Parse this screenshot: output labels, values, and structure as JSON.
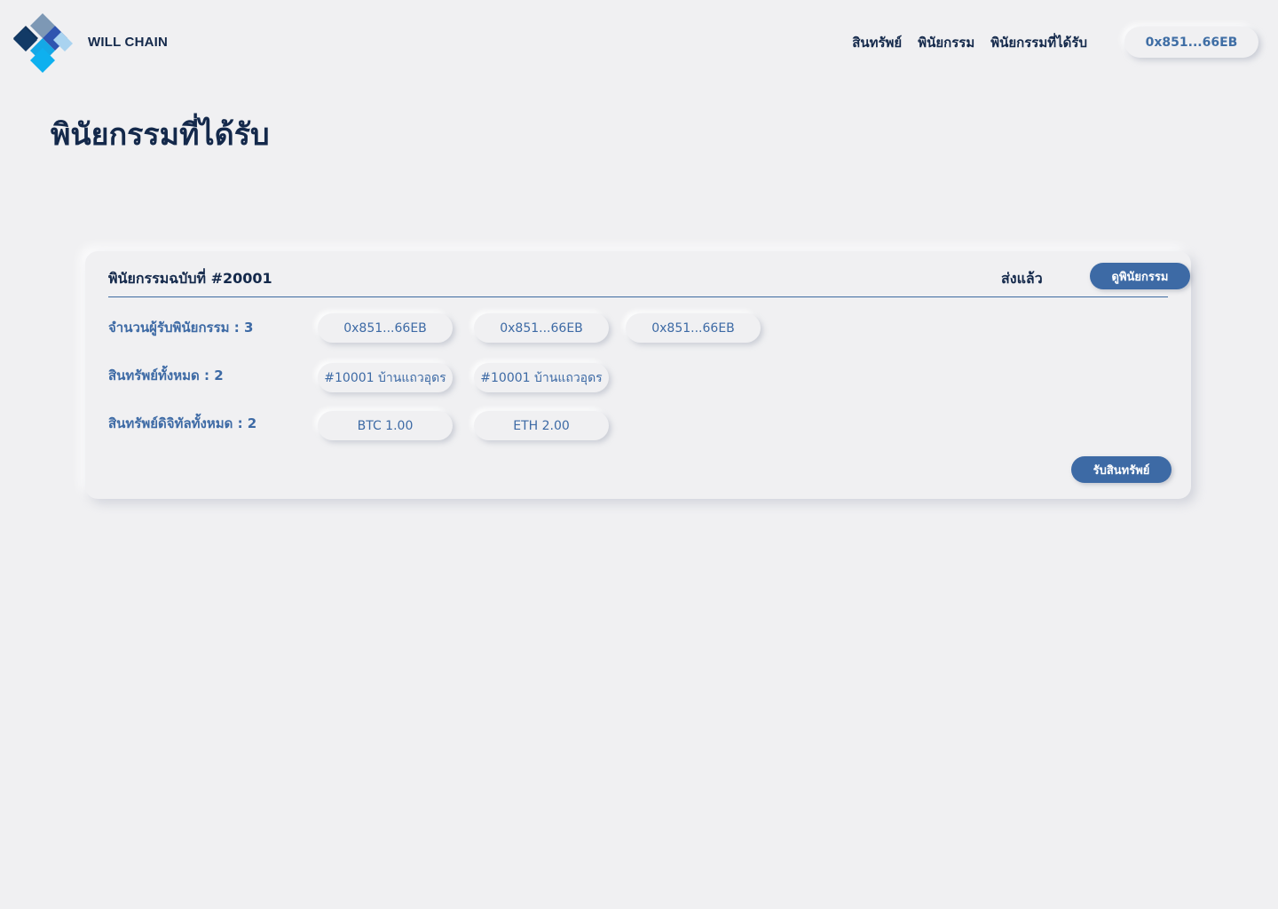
{
  "header": {
    "brand": "WILL CHAIN",
    "nav": [
      "สินทรัพย์",
      "พินัยกรรม",
      "พินัยกรรมที่ได้รับ"
    ],
    "wallet": "0x851...66EB"
  },
  "page": {
    "title": "พินัยกรรมที่ได้รับ"
  },
  "card": {
    "title": "พินัยกรรมฉบับที่ #20001",
    "status": "ส่งแล้ว",
    "view_button": "ดูพินัยกรรม",
    "receive_button": "รับสินทรัพย์",
    "rows": [
      {
        "label": "จำนวนผู้รับพินัยกรรม : 3",
        "items": [
          "0x851...66EB",
          "0x851...66EB",
          "0x851...66EB"
        ]
      },
      {
        "label": "สินทรัพย์ทั้งหมด : 2",
        "items": [
          "#10001 บ้านแถวอุดร",
          "#10001 บ้านแถวอุดร"
        ]
      },
      {
        "label": "สินทรัพย์ดิจิทัลทั้งหมด : 2",
        "items": [
          "BTC 1.00",
          "ETH 2.00"
        ]
      }
    ]
  },
  "colors": {
    "accent": "#3d6aa5",
    "text": "#14294b",
    "background": "#f0f0f2"
  }
}
